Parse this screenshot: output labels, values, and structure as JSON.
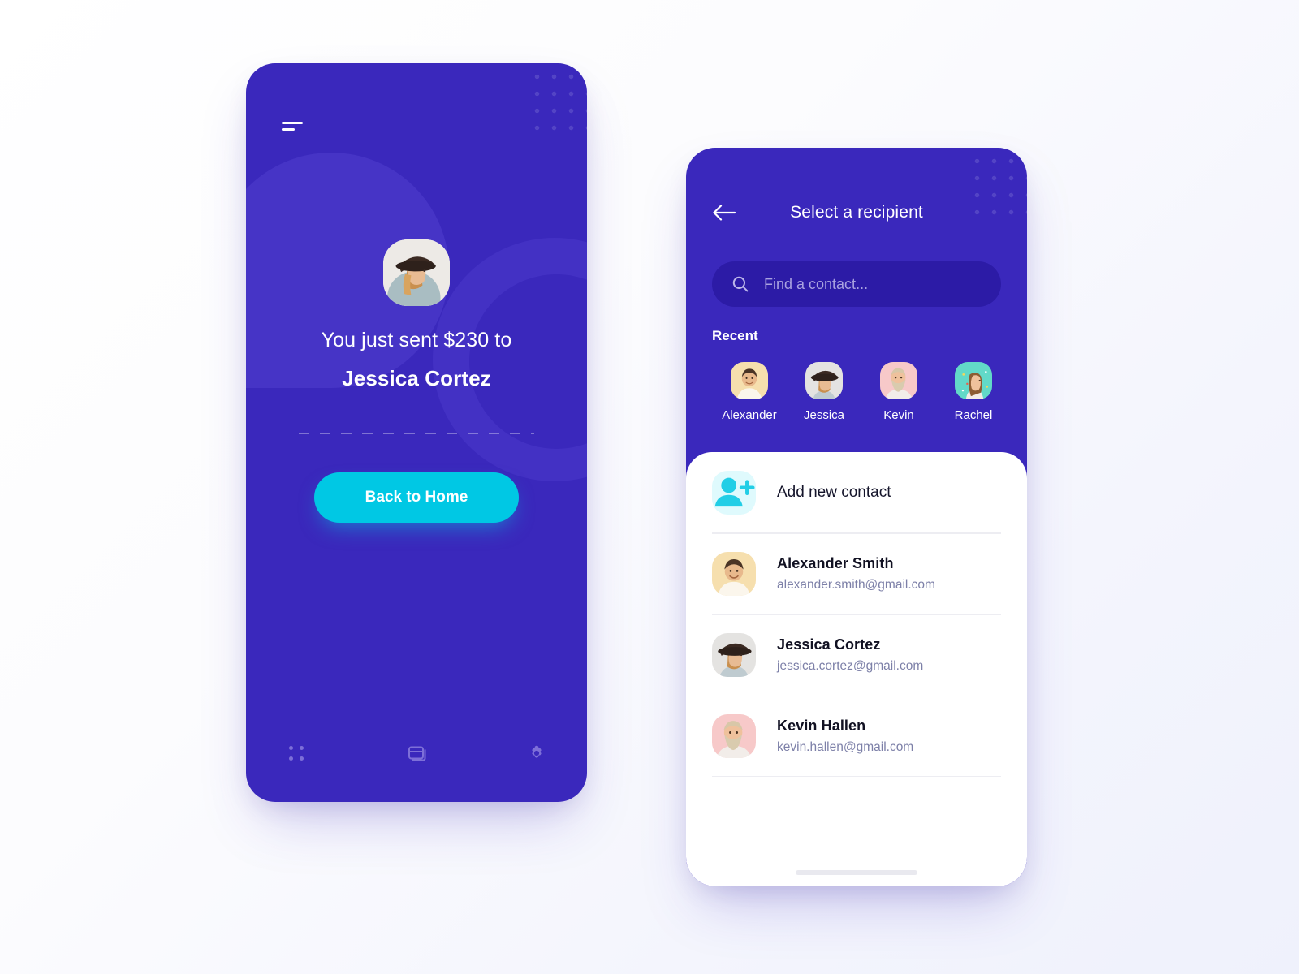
{
  "theme": {
    "purple": "#3A28BC",
    "purple_dark": "#2C1BA6",
    "cyan": "#00C8E4",
    "cyan_light": "#DFFAFD",
    "white": "#FFFFFF",
    "muted_text": "#7D80A8",
    "page_bg": "#F2F3FD"
  },
  "screen_success": {
    "menu_icon": "hamburger-menu-icon",
    "avatar": {
      "name": "jessica-avatar",
      "alt": "Jessica Cortez photo"
    },
    "sent_line": "You just sent $230 to",
    "recipient_name": "Jessica Cortez",
    "amount": "$230",
    "cta_label": "Back to Home",
    "tabs": [
      {
        "id": "grid",
        "icon": "grid-dots-icon",
        "label": "Dashboard"
      },
      {
        "id": "cards",
        "icon": "cards-icon",
        "label": "Cards"
      },
      {
        "id": "settings",
        "icon": "gear-icon",
        "label": "Settings"
      }
    ]
  },
  "screen_recipient": {
    "back_icon": "arrow-left-icon",
    "title": "Select a recipient",
    "search": {
      "icon": "search-icon",
      "placeholder": "Find a contact...",
      "value": ""
    },
    "recent_label": "Recent",
    "recent": [
      {
        "name": "Alexander",
        "avatar_bg": "#F6DFAE"
      },
      {
        "name": "Jessica",
        "avatar_bg": "#E4E3E1"
      },
      {
        "name": "Kevin",
        "avatar_bg": "#F7C9C9"
      },
      {
        "name": "Rachel",
        "avatar_bg": "#62D9C8"
      }
    ],
    "add_new": {
      "icon": "add-person-icon",
      "label": "Add new contact"
    },
    "contacts": [
      {
        "name": "Alexander Smith",
        "email": "alexander.smith@gmail.com",
        "avatar_bg": "#F6DFAE"
      },
      {
        "name": "Jessica Cortez",
        "email": "jessica.cortez@gmail.com",
        "avatar_bg": "#E4E3E1"
      },
      {
        "name": "Kevin Hallen",
        "email": "kevin.hallen@gmail.com",
        "avatar_bg": "#F7C9C9"
      }
    ]
  }
}
